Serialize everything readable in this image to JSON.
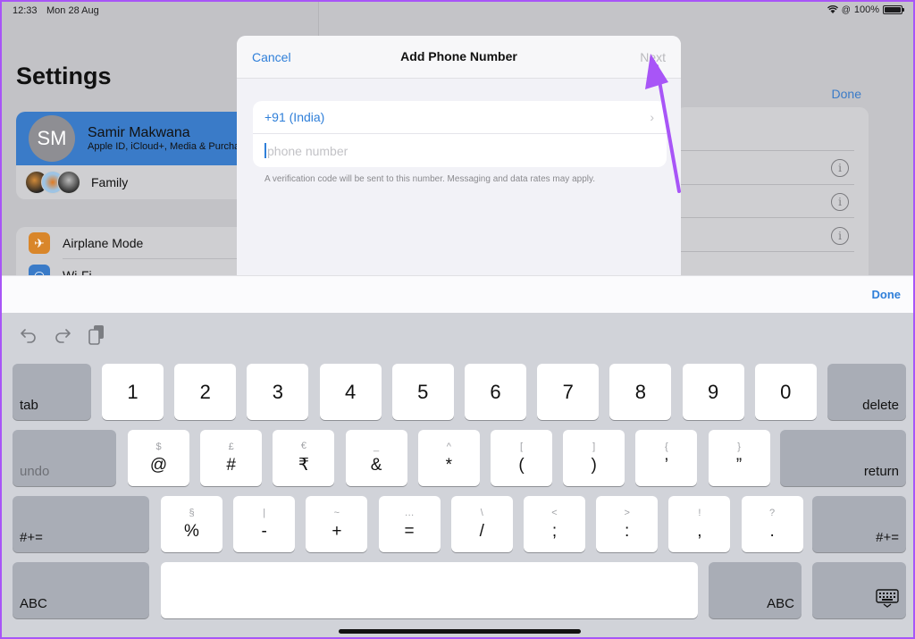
{
  "status_bar": {
    "time": "12:33",
    "date": "Mon 28 Aug",
    "battery": "100%"
  },
  "sidebar": {
    "title": "Settings",
    "profile": {
      "initials": "SM",
      "name": "Samir Makwana",
      "subtitle": "Apple ID, iCloud+, Media & Purchases"
    },
    "family_label": "Family",
    "items": [
      {
        "label": "Airplane Mode",
        "icon": "airplane-icon"
      },
      {
        "label": "Wi-Fi",
        "icon": "wifi-icon"
      }
    ]
  },
  "right_pane": {
    "done_label": "Done"
  },
  "modal": {
    "cancel_label": "Cancel",
    "title": "Add Phone Number",
    "next_label": "Next",
    "country": "+91 (India)",
    "phone_placeholder": "phone number",
    "phone_value": "",
    "helper": "A verification code will be sent to this number. Messaging and data rates may apply."
  },
  "accessory": {
    "done_label": "Done"
  },
  "keyboard": {
    "row1": [
      "1",
      "2",
      "3",
      "4",
      "5",
      "6",
      "7",
      "8",
      "9",
      "0"
    ],
    "row1_left": "tab",
    "row1_right": "delete",
    "row2": [
      {
        "sub": "$",
        "main": "@"
      },
      {
        "sub": "£",
        "main": "#"
      },
      {
        "sub": "€",
        "main": "₹"
      },
      {
        "sub": "_",
        "main": "&"
      },
      {
        "sub": "^",
        "main": "*"
      },
      {
        "sub": "[",
        "main": "("
      },
      {
        "sub": "]",
        "main": ")"
      },
      {
        "sub": "{",
        "main": "’"
      },
      {
        "sub": "}",
        "main": "”"
      }
    ],
    "row2_left": "undo",
    "row2_right": "return",
    "row3": [
      {
        "sub": "§",
        "main": "%"
      },
      {
        "sub": "|",
        "main": "-"
      },
      {
        "sub": "~",
        "main": "+"
      },
      {
        "sub": "…",
        "main": "="
      },
      {
        "sub": "\\",
        "main": "/"
      },
      {
        "sub": "<",
        "main": ";"
      },
      {
        "sub": ">",
        "main": ":"
      },
      {
        "sub": "!",
        "main": ","
      },
      {
        "sub": "?",
        "main": "."
      }
    ],
    "row3_left": "#+=",
    "row3_right": "#+=",
    "row4_left": "ABC",
    "row4_right": "ABC"
  },
  "colors": {
    "accent": "#2f7fd9",
    "annotation": "#a855f7",
    "keyboard_bg": "#d1d3d9"
  }
}
